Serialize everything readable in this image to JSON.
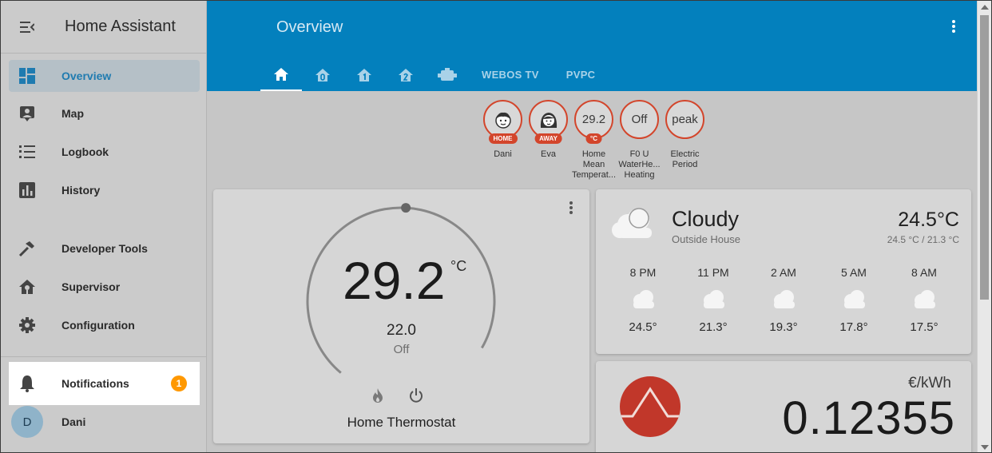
{
  "app": {
    "title": "Home Assistant"
  },
  "sidebar": {
    "items": [
      {
        "label": "Overview",
        "icon": "dashboard-icon",
        "active": true
      },
      {
        "label": "Map",
        "icon": "map-account-icon"
      },
      {
        "label": "Logbook",
        "icon": "logbook-icon"
      },
      {
        "label": "History",
        "icon": "history-chart-icon"
      },
      {
        "label": "Developer Tools",
        "icon": "hammer-icon"
      },
      {
        "label": "Supervisor",
        "icon": "supervisor-icon"
      },
      {
        "label": "Configuration",
        "icon": "gear-icon"
      }
    ],
    "notifications": {
      "label": "Notifications",
      "count": "1"
    },
    "user": {
      "initial": "D",
      "name": "Dani"
    }
  },
  "header": {
    "title": "Overview",
    "tabs": [
      {
        "icon": "home-icon",
        "active": true
      },
      {
        "icon": "home-floor-0-icon"
      },
      {
        "icon": "home-floor-1-icon"
      },
      {
        "icon": "home-floor-2-icon"
      },
      {
        "icon": "water-heater-icon"
      },
      {
        "label": "WEBOS TV"
      },
      {
        "label": "PVPC"
      }
    ]
  },
  "badges": [
    {
      "kind": "person",
      "tag": "HOME",
      "name": "Dani"
    },
    {
      "kind": "person",
      "tag": "AWAY",
      "name": "Eva"
    },
    {
      "value": "29.2",
      "tag": "°C",
      "name": "Home Mean Temperat..."
    },
    {
      "value": "Off",
      "name": "F0 U WaterHe... Heating"
    },
    {
      "value": "peak",
      "name": "Electric Period"
    }
  ],
  "thermostat": {
    "current": "29.2",
    "unit": "°C",
    "target": "22.0",
    "mode": "Off",
    "name": "Home Thermostat",
    "setpoint_fraction": 0.55
  },
  "weather": {
    "condition": "Cloudy",
    "location": "Outside House",
    "temperature": "24.5°C",
    "range": "24.5 °C / 21.3 °C",
    "forecast": [
      {
        "time": "8 PM",
        "temp": "24.5°"
      },
      {
        "time": "11 PM",
        "temp": "21.3°"
      },
      {
        "time": "2 AM",
        "temp": "19.3°"
      },
      {
        "time": "5 AM",
        "temp": "17.8°"
      },
      {
        "time": "8 AM",
        "temp": "17.5°"
      }
    ]
  },
  "price": {
    "unit": "€/kWh",
    "value": "0.12355"
  },
  "colors": {
    "header": "#0380bd",
    "accent": "#1f7bb0",
    "badge_ring": "#d3452b",
    "notification_badge": "#ff9800",
    "price_logo": "#c1372a"
  }
}
